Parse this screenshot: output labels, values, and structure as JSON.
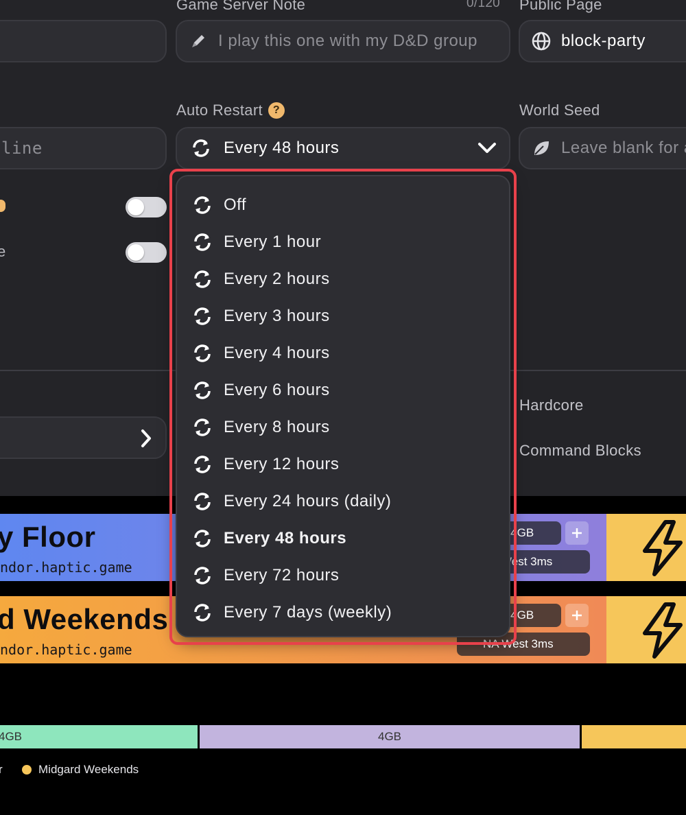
{
  "fields": {
    "note_label": "Game Server Note",
    "note_counter": "0/120",
    "note_placeholder": "I play this one with my D&D group",
    "public_label": "Public Page",
    "public_value": "block-party",
    "restart_label": "Auto Restart",
    "restart_value": "Every 48 hours",
    "seed_label": "World Seed",
    "seed_placeholder": "Leave blank for a",
    "left_field_fragment": "line",
    "left_toggle2_fragment": "e"
  },
  "settings": {
    "hardcore_label": "Hardcore",
    "command_blocks_label": "Command Blocks"
  },
  "dropdown": {
    "options": [
      {
        "label": "Off"
      },
      {
        "label": "Every 1 hour"
      },
      {
        "label": "Every 2 hours"
      },
      {
        "label": "Every 3 hours"
      },
      {
        "label": "Every 4 hours"
      },
      {
        "label": "Every 6 hours"
      },
      {
        "label": "Every 8 hours"
      },
      {
        "label": "Every 12 hours"
      },
      {
        "label": "Every 24 hours (daily)"
      },
      {
        "label": "Every 48 hours",
        "selected": true
      },
      {
        "label": "Every 72 hours"
      },
      {
        "label": "Every 7 days (weekly)"
      }
    ]
  },
  "servers": [
    {
      "title": "y Floor",
      "host": "ndor.haptic.game",
      "memory": "6/4GB",
      "region": "West 3ms",
      "color_from": "#5f87f0",
      "color_to": "#8f7fdc"
    },
    {
      "title": "d Weekends",
      "host": "ndor.haptic.game",
      "memory": "3/4GB",
      "region": "NA West 3ms",
      "color_from": "#f5a93e",
      "color_to": "#f08a56"
    }
  ],
  "memory_bar": {
    "segments": [
      {
        "label": "4GB",
        "color": "#8ee6bd"
      },
      {
        "label": "4GB",
        "color": "#c2b4de"
      },
      {
        "label": "",
        "color": "#f6c65a"
      }
    ]
  },
  "legend": {
    "items": [
      {
        "label": "r",
        "color": ""
      },
      {
        "label": "Midgard Weekends",
        "color": "#f6c65a"
      }
    ]
  },
  "colors": {
    "accent_highlight": "#e8414b",
    "panel_bg": "#242428"
  }
}
